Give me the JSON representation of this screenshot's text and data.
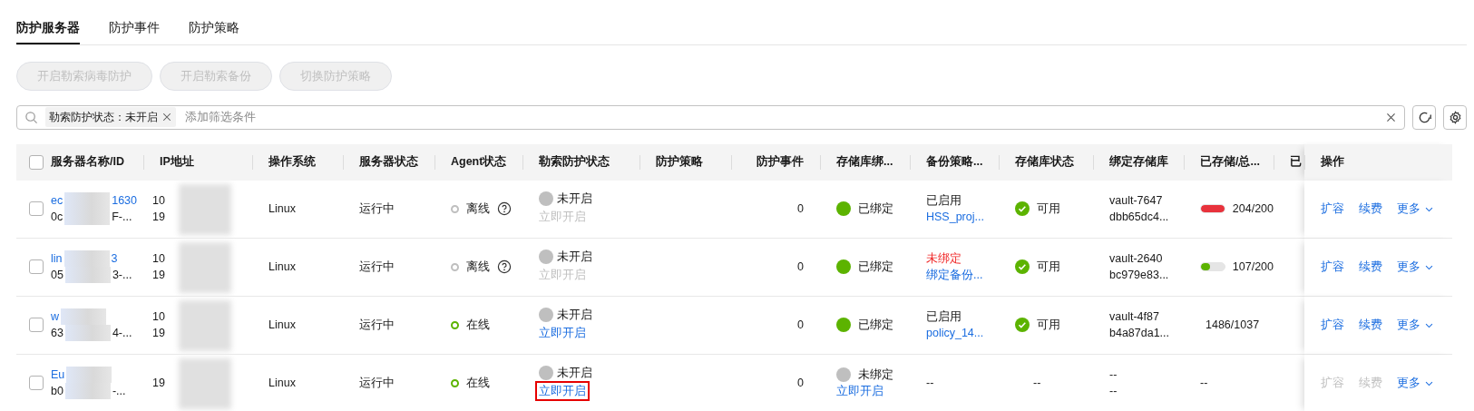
{
  "tabs": [
    {
      "label": "防护服务器",
      "selected": true
    },
    {
      "label": "防护事件",
      "selected": false
    },
    {
      "label": "防护策略",
      "selected": false
    }
  ],
  "toolbar_buttons": [
    {
      "label": "开启勒索病毒防护",
      "disabled": true
    },
    {
      "label": "开启勒索备份",
      "disabled": true
    },
    {
      "label": "切换防护策略",
      "disabled": true
    }
  ],
  "filter": {
    "tags": [
      {
        "label": "勒索防护状态：未开启"
      }
    ],
    "placeholder": "添加筛选条件"
  },
  "table": {
    "select_all": {
      "checked": false
    },
    "columns": [
      {
        "label": "服务器名称/ID"
      },
      {
        "label": "IP地址"
      },
      {
        "label": "操作系统"
      },
      {
        "label": "服务器状态"
      },
      {
        "label": "Agent状态"
      },
      {
        "label": "勒索防护状态"
      },
      {
        "label": "防护策略"
      },
      {
        "label": "防护事件"
      },
      {
        "label": "存储库绑..."
      },
      {
        "label": "备份策略..."
      },
      {
        "label": "存储库状态"
      },
      {
        "label": "绑定存储库"
      },
      {
        "label": "已存储/总..."
      },
      {
        "label": "已"
      },
      {
        "label": "操作"
      }
    ],
    "rows": [
      {
        "checked": false,
        "name": [
          "ec",
          "1630"
        ],
        "id": [
          "0c",
          "F-..."
        ],
        "ip": [
          "10",
          "19"
        ],
        "os": "Linux",
        "server_status": "运行中",
        "agent": {
          "label": "离线",
          "online": false,
          "help": true
        },
        "ransom": {
          "label": "未开启",
          "action": {
            "label": "立即开启",
            "disabled": true,
            "highlighted": false
          }
        },
        "events": "0",
        "bind": {
          "label": "已绑定",
          "bound": true
        },
        "backup": {
          "kind": "policy",
          "status": "已启用",
          "alert": false,
          "link": "HSS_proj..."
        },
        "vault_status": {
          "kind": "ok",
          "label": "可用"
        },
        "vault": [
          "vault-7647",
          "dbb65dc4..."
        ],
        "stored": {
          "kind": "bar",
          "text": "204/200",
          "level": 1,
          "color": "#e8323c"
        },
        "actions": [
          {
            "label": "扩容",
            "disabled": false,
            "kind": "link"
          },
          {
            "label": "续费",
            "disabled": false,
            "kind": "link"
          },
          {
            "label": "更多",
            "disabled": false,
            "kind": "dropdown"
          }
        ]
      },
      {
        "checked": false,
        "name": [
          "lin",
          "3"
        ],
        "id": [
          "05",
          "3-..."
        ],
        "ip": [
          "10",
          "19"
        ],
        "os": "Linux",
        "server_status": "运行中",
        "agent": {
          "label": "离线",
          "online": false,
          "help": true
        },
        "ransom": {
          "label": "未开启",
          "action": {
            "label": "立即开启",
            "disabled": true,
            "highlighted": false
          }
        },
        "events": "0",
        "bind": {
          "label": "已绑定",
          "bound": true
        },
        "backup": {
          "kind": "policy",
          "status": "未绑定",
          "alert": true,
          "link": "绑定备份..."
        },
        "vault_status": {
          "kind": "ok",
          "label": "可用"
        },
        "vault": [
          "vault-2640",
          "bc979e83..."
        ],
        "stored": {
          "kind": "bar",
          "text": "107/200",
          "level": 0.4,
          "color": "#5cb300"
        },
        "actions": [
          {
            "label": "扩容",
            "disabled": false,
            "kind": "link"
          },
          {
            "label": "续费",
            "disabled": false,
            "kind": "link"
          },
          {
            "label": "更多",
            "disabled": false,
            "kind": "dropdown"
          }
        ]
      },
      {
        "checked": false,
        "name": [
          "w"
        ],
        "id": [
          "63",
          "4-..."
        ],
        "ip": [
          "10",
          "19"
        ],
        "os": "Linux",
        "server_status": "运行中",
        "agent": {
          "label": "在线",
          "online": true,
          "help": false
        },
        "ransom": {
          "label": "未开启",
          "action": {
            "label": "立即开启",
            "disabled": false,
            "highlighted": false
          }
        },
        "events": "0",
        "bind": {
          "label": "已绑定",
          "bound": true
        },
        "backup": {
          "kind": "policy",
          "status": "已启用",
          "alert": false,
          "link": "policy_14..."
        },
        "vault_status": {
          "kind": "ok",
          "label": "可用"
        },
        "vault": [
          "vault-4f87",
          "b4a87da1..."
        ],
        "stored": {
          "kind": "text",
          "text": "1486/1037"
        },
        "actions": [
          {
            "label": "扩容",
            "disabled": false,
            "kind": "link"
          },
          {
            "label": "续费",
            "disabled": false,
            "kind": "link"
          },
          {
            "label": "更多",
            "disabled": false,
            "kind": "dropdown"
          }
        ]
      },
      {
        "checked": false,
        "name": [
          "Eu"
        ],
        "id": [
          "b0",
          "-..."
        ],
        "ip": [
          "19"
        ],
        "os": "Linux",
        "server_status": "运行中",
        "agent": {
          "label": "在线",
          "online": true,
          "help": false
        },
        "ransom": {
          "label": "未开启",
          "action": {
            "label": "立即开启",
            "disabled": false,
            "highlighted": true
          }
        },
        "events": "0",
        "bind": {
          "label": "未绑定",
          "bound": false,
          "action": "立即开启"
        },
        "backup": {
          "kind": "text",
          "text": "--"
        },
        "vault_status": {
          "kind": "text",
          "label": "--"
        },
        "vault": [
          "--",
          "--"
        ],
        "stored": {
          "kind": "text",
          "text": "--"
        },
        "actions": [
          {
            "label": "扩容",
            "disabled": true,
            "kind": "link"
          },
          {
            "label": "续费",
            "disabled": true,
            "kind": "link"
          },
          {
            "label": "更多",
            "disabled": false,
            "kind": "dropdown"
          }
        ]
      }
    ]
  }
}
